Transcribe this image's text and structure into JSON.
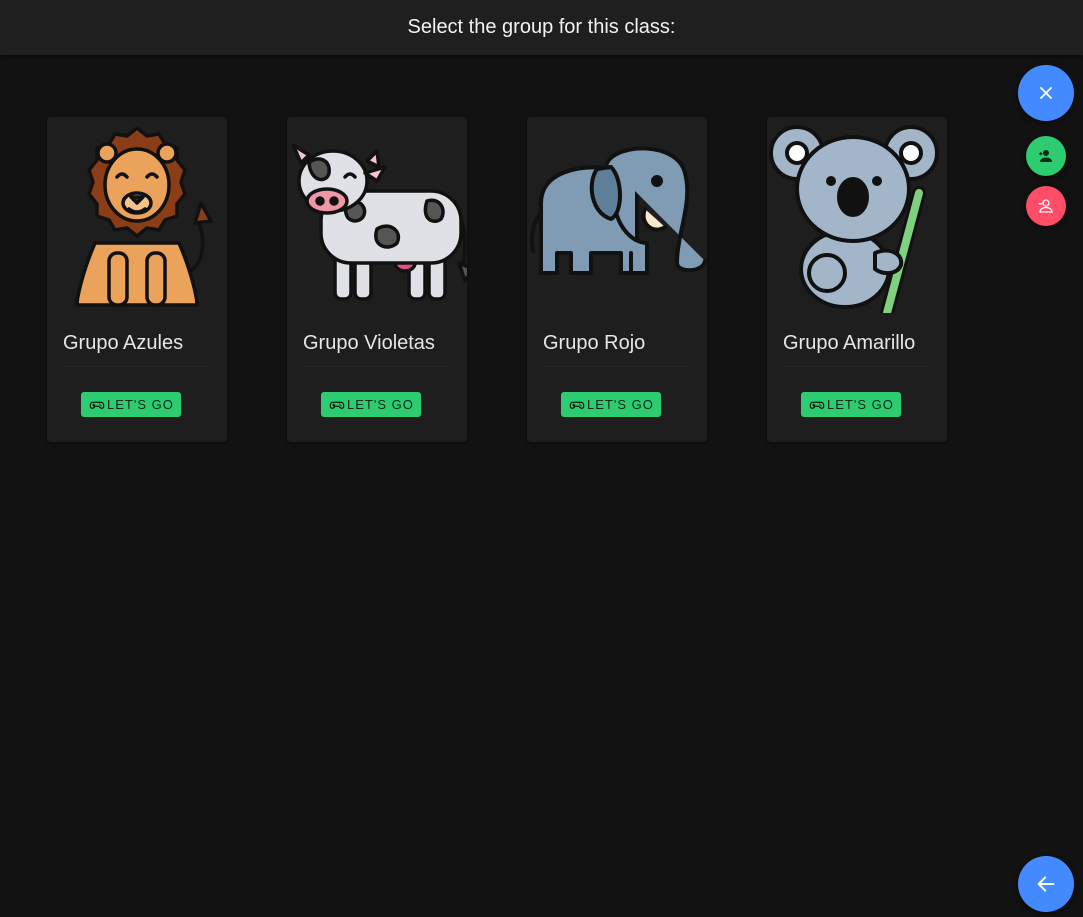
{
  "header": {
    "title": "Select the group for this class:"
  },
  "groups": [
    {
      "name": "Grupo Azules",
      "button": "LET'S GO",
      "animal": "lion"
    },
    {
      "name": "Grupo Violetas",
      "button": "LET'S GO",
      "animal": "cow"
    },
    {
      "name": "Grupo Rojo",
      "button": "LET'S GO",
      "animal": "elephant"
    },
    {
      "name": "Grupo Amarillo",
      "button": "LET'S GO",
      "animal": "koala"
    }
  ],
  "fabs": {
    "close_icon": "close-icon",
    "add_icon": "person-add-icon",
    "remove_icon": "person-remove-icon",
    "back_icon": "arrow-left-icon"
  },
  "colors": {
    "background": "#121212",
    "card": "#1e1e1e",
    "accent_blue": "#448aff",
    "go_green": "#2ecc71",
    "remove_red": "#ff4d67"
  }
}
